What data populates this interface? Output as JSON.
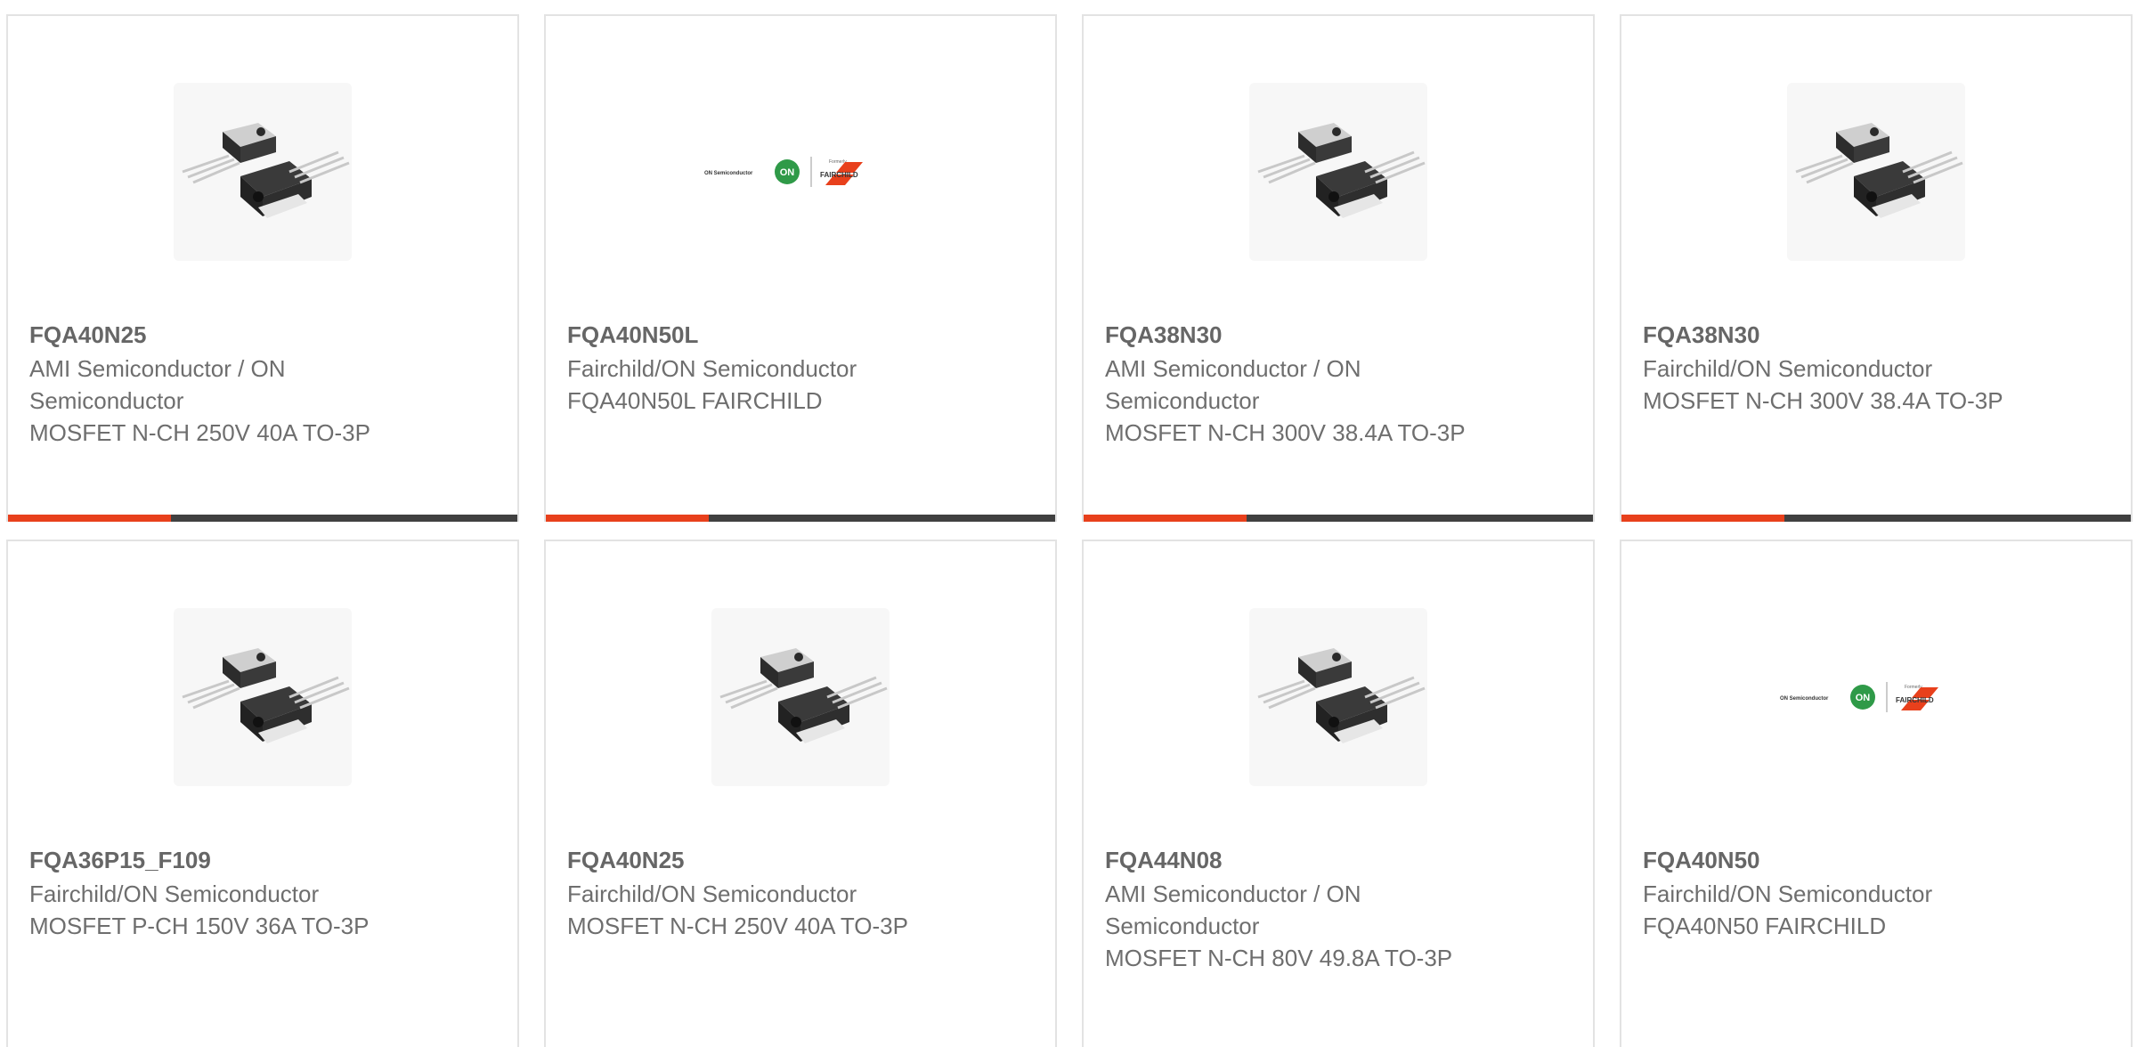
{
  "colors": {
    "accent": "#e8401c",
    "bar": "#404040",
    "border": "#e3e3e3",
    "text": "#6e6e6e"
  },
  "products": [
    {
      "part_number": "FQA40N25",
      "manufacturer": "AMI Semiconductor / ON Semiconductor",
      "description": "MOSFET N-CH 250V 40A TO-3P",
      "image": "to-3p-mosfet-icon"
    },
    {
      "part_number": "FQA40N50L",
      "manufacturer": "Fairchild/ON Semiconductor",
      "description": "FQA40N50L FAIRCHILD",
      "image": "on-fairchild-logo"
    },
    {
      "part_number": "FQA38N30",
      "manufacturer": "AMI Semiconductor / ON Semiconductor",
      "description": "MOSFET N-CH 300V 38.4A TO-3P",
      "image": "to-3p-mosfet-icon"
    },
    {
      "part_number": "FQA38N30",
      "manufacturer": "Fairchild/ON Semiconductor",
      "description": "MOSFET N-CH 300V 38.4A TO-3P",
      "image": "to-3p-mosfet-icon"
    },
    {
      "part_number": "FQA36P15_F109",
      "manufacturer": "Fairchild/ON Semiconductor",
      "description": "MOSFET P-CH 150V 36A TO-3P",
      "image": "to-3p-mosfet-icon"
    },
    {
      "part_number": "FQA40N25",
      "manufacturer": "Fairchild/ON Semiconductor",
      "description": "MOSFET N-CH 250V 40A TO-3P",
      "image": "to-3p-mosfet-icon"
    },
    {
      "part_number": "FQA44N08",
      "manufacturer": "AMI Semiconductor / ON Semiconductor",
      "description": "MOSFET N-CH 80V 49.8A TO-3P",
      "image": "to-3p-mosfet-icon"
    },
    {
      "part_number": "FQA40N50",
      "manufacturer": "Fairchild/ON Semiconductor",
      "description": "FQA40N50 FAIRCHILD",
      "image": "on-fairchild-logo"
    }
  ],
  "logo_text": {
    "on_semi": "ON Semiconductor",
    "on": "ON",
    "formerly": "Formerly",
    "fairchild": "FAIRCHILD"
  }
}
